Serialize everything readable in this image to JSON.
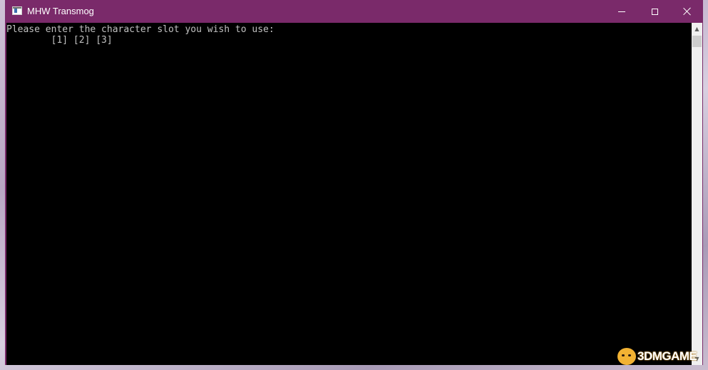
{
  "window": {
    "title": "MHW Transmog",
    "app_icon": "console-app-icon",
    "buttons": {
      "minimize": "minimize-icon",
      "maximize": "maximize-icon",
      "close": "close-icon"
    },
    "accent_color": "#7a2a6a"
  },
  "console": {
    "lines": [
      "Please enter the character slot you wish to use:",
      "        [1] [2] [3]"
    ],
    "text_color": "#c0c0c0",
    "background_color": "#000000"
  },
  "scrollbar": {
    "up_icon": "scroll-up-arrow-icon",
    "down_icon": "scroll-down-arrow-icon"
  },
  "watermark": {
    "text": "3DMGAME"
  }
}
